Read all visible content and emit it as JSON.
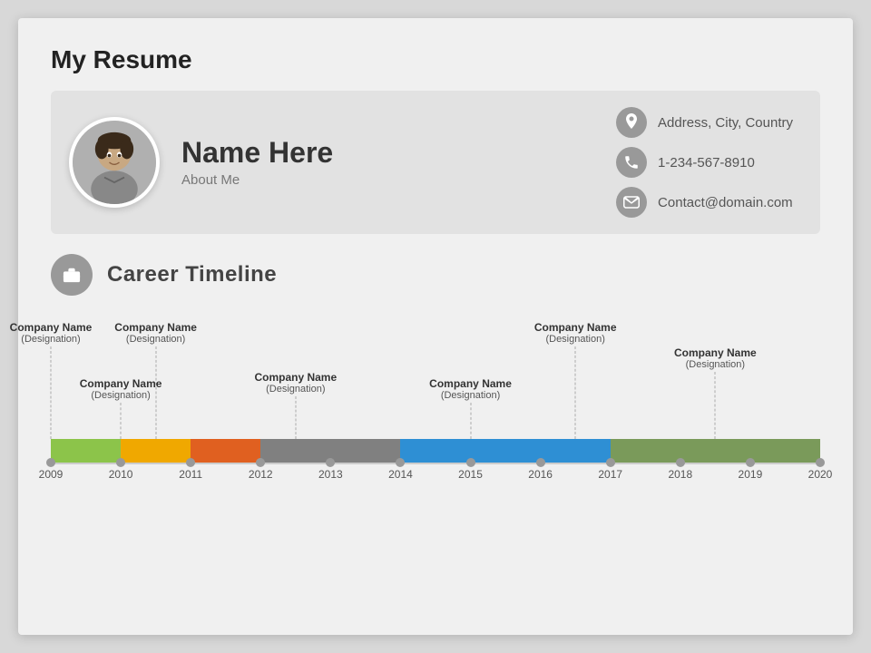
{
  "slide": {
    "title": "My Resume",
    "header": {
      "name": "Name Here",
      "about": "About Me",
      "contact": {
        "address": "Address, City, Country",
        "phone": "1-234-567-8910",
        "email": "Contact@domain.com"
      }
    },
    "career": {
      "section_title": "Career Timeline",
      "entries_top": [
        {
          "company": "Company Name",
          "designation": "(Designation)",
          "year": 2009,
          "row": "top"
        },
        {
          "company": "Company Name",
          "designation": "(Designation)",
          "year": 2010.5,
          "row": "top"
        },
        {
          "company": "Company Name",
          "designation": "(Designation)",
          "year": 2016.5,
          "row": "top"
        },
        {
          "company": "Company Name",
          "designation": "(Designation)",
          "year": 2018.5,
          "row": "top"
        }
      ],
      "entries_bottom": [
        {
          "company": "Company Name",
          "designation": "(Designation)",
          "year": 2010,
          "row": "bottom"
        },
        {
          "company": "Company Name",
          "designation": "(Designation)",
          "year": 2012.5,
          "row": "bottom"
        },
        {
          "company": "Company Name",
          "designation": "(Designation)",
          "year": 2015,
          "row": "bottom"
        }
      ],
      "bars": [
        {
          "start": 2009,
          "end": 2010,
          "color": "#8cc44a"
        },
        {
          "start": 2010,
          "end": 2011,
          "color": "#f0a800"
        },
        {
          "start": 2011,
          "end": 2012,
          "color": "#e06020"
        },
        {
          "start": 2012,
          "end": 2014,
          "color": "#808080"
        },
        {
          "start": 2014,
          "end": 2017,
          "color": "#2e8fd4"
        },
        {
          "start": 2017,
          "end": 2020,
          "color": "#7a9a5a"
        }
      ],
      "years": [
        2009,
        2010,
        2011,
        2012,
        2013,
        2014,
        2015,
        2016,
        2017,
        2018,
        2019,
        2020
      ]
    }
  }
}
